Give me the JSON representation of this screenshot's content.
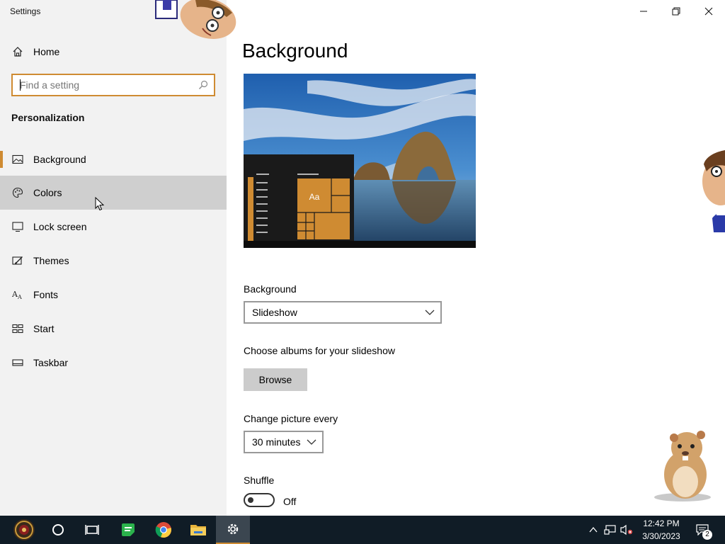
{
  "window": {
    "title": "Settings",
    "minimize_icon": "minimize-icon",
    "restore_icon": "restore-icon",
    "close_icon": "close-icon"
  },
  "sidebar": {
    "home_label": "Home",
    "search_placeholder": "Find a setting",
    "section_title": "Personalization",
    "items": [
      {
        "label": "Background",
        "icon": "picture-icon",
        "selected": true
      },
      {
        "label": "Colors",
        "icon": "palette-icon",
        "hover": true
      },
      {
        "label": "Lock screen",
        "icon": "monitor-lock-icon"
      },
      {
        "label": "Themes",
        "icon": "themes-brush-icon"
      },
      {
        "label": "Fonts",
        "icon": "fonts-icon"
      },
      {
        "label": "Start",
        "icon": "start-tiles-icon"
      },
      {
        "label": "Taskbar",
        "icon": "taskbar-icon"
      }
    ]
  },
  "main": {
    "title": "Background",
    "preview": {
      "tile_text": "Aa"
    },
    "background_label": "Background",
    "background_value": "Slideshow",
    "albums_label": "Choose albums for your slideshow",
    "browse_label": "Browse",
    "interval_label": "Change picture every",
    "interval_value": "30 minutes",
    "shuffle_label": "Shuffle",
    "shuffle_state": "Off"
  },
  "taskbar": {
    "time": "12:42 PM",
    "date": "3/30/2023",
    "notification_count": "2",
    "apps": [
      "start-icon",
      "cortana-icon",
      "task-view-icon",
      "notes-app-icon",
      "chrome-icon",
      "file-explorer-icon",
      "settings-gear-icon"
    ]
  },
  "colors": {
    "accent": "#cf8b32",
    "sidebar_bg": "#f2f2f2",
    "hover_bg": "#cfcfcf",
    "taskbar_bg": "#101c26"
  }
}
